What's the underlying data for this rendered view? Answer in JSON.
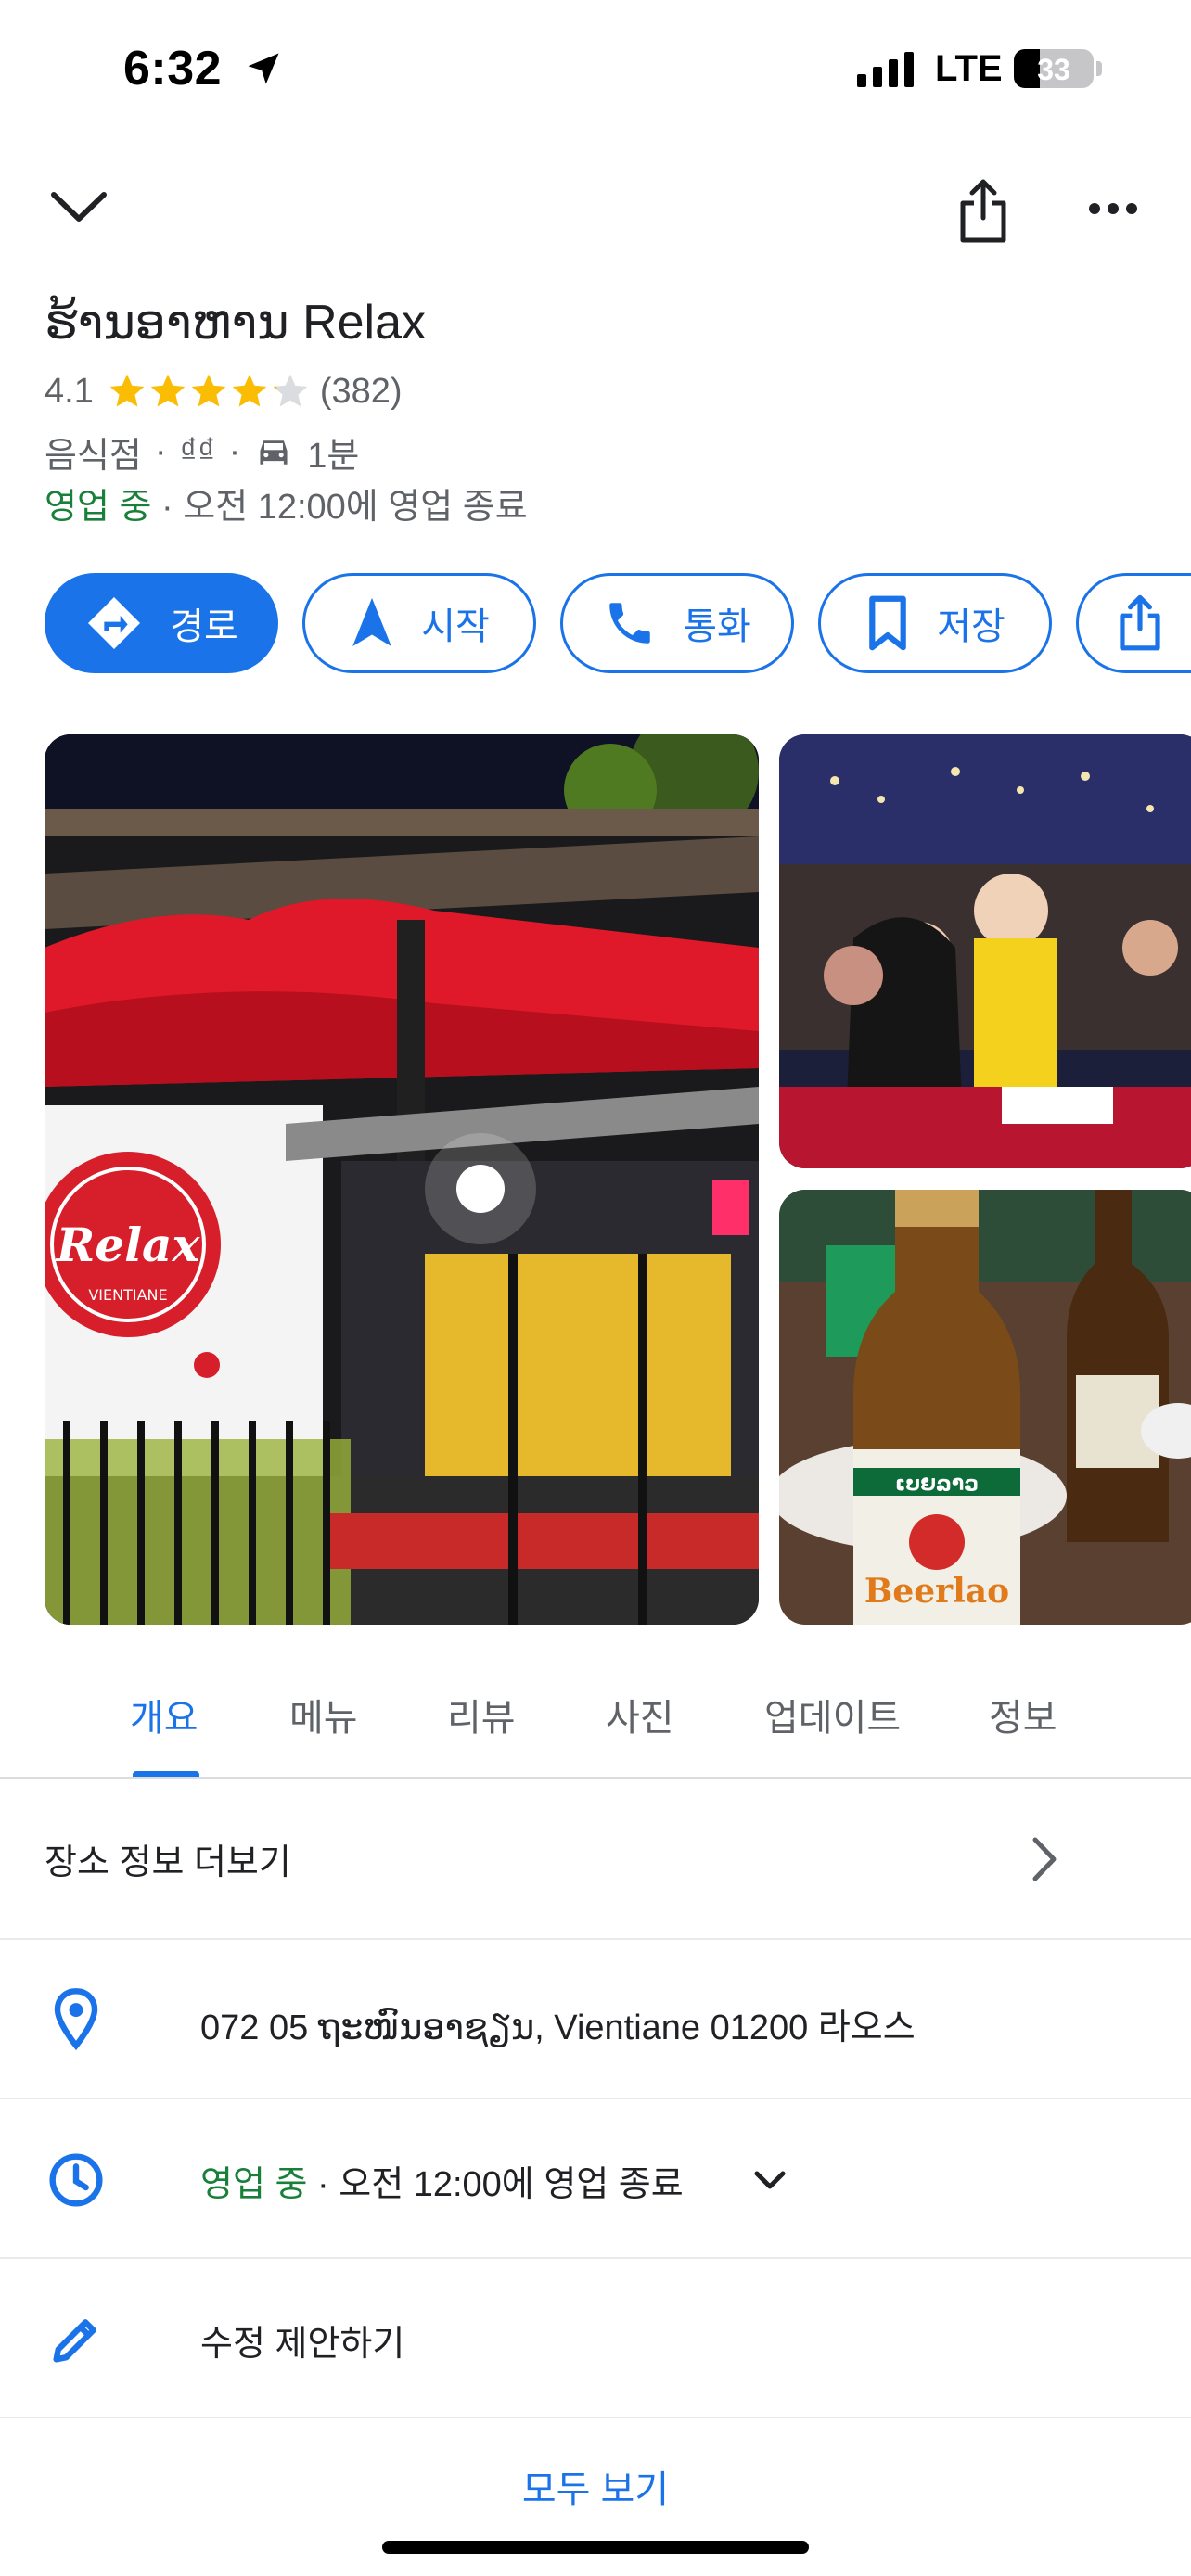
{
  "status_bar": {
    "time": "6:32",
    "network": "LTE",
    "battery": "33",
    "battery_level": 0.33
  },
  "top_bar": {
    "collapse_icon": "chevron-down-icon",
    "share_icon": "share-icon",
    "more_icon": "more-horizontal-icon"
  },
  "place": {
    "title": "ຮ້ານອາຫານ Relax",
    "rating": "4.1",
    "rating_value": 4.1,
    "review_count": "(382)",
    "category": "음식점",
    "price": "₫₫",
    "drive_time": "1분",
    "open_status": "영업 중",
    "hours_detail": "오전 12:00에 영업 종료"
  },
  "actions": [
    {
      "label": "경로",
      "icon": "directions-icon",
      "primary": true
    },
    {
      "label": "시작",
      "icon": "navigation-icon",
      "primary": false
    },
    {
      "label": "통화",
      "icon": "phone-icon",
      "primary": false
    },
    {
      "label": "저장",
      "icon": "bookmark-icon",
      "primary": false
    },
    {
      "label": "",
      "icon": "share-icon",
      "primary": false
    }
  ],
  "tabs": [
    "개요",
    "메뉴",
    "리뷰",
    "사진",
    "업데이트",
    "정보"
  ],
  "active_tab": "개요",
  "info": {
    "more_place_info": "장소 정보 더보기",
    "address": "072 05 ຖະໜົນອາຊຽນ, Vientiane 01200 라오스",
    "hours_open": "영업 중",
    "hours_text": "오전 12:00에 영업 종료",
    "suggest_edit": "수정 제안하기",
    "see_all": "모두 보기"
  },
  "photos": {
    "main_sign": "Relax",
    "main_sign_sub": "VIENTIANE",
    "beer_label": "Beerlao",
    "beer_lao_text": "ເບຍລາວ"
  },
  "colors": {
    "accent": "#1a73e8",
    "open_green": "#188038",
    "star": "#fbbc04",
    "secondary_text": "#5f6368"
  }
}
